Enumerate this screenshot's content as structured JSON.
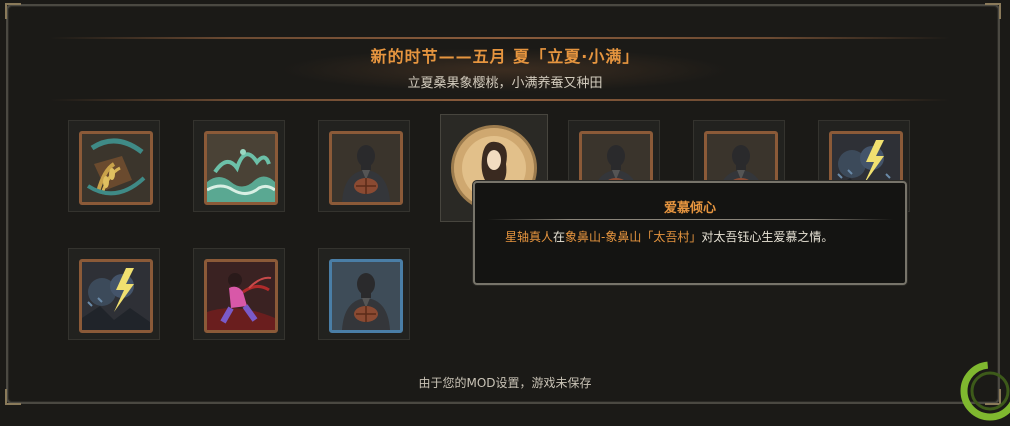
{
  "header": {
    "title": "新的时节——五月 夏「立夏·小满」",
    "subtitle": "立夏桑果象樱桃，小满养蚕又种田"
  },
  "events": [
    {
      "icon": "grain-harvest-icon"
    },
    {
      "icon": "sea-waves-icon"
    },
    {
      "icon": "person-holding-ball-icon"
    },
    {
      "icon": "woman-portrait-icon",
      "selected": true
    },
    {
      "icon": "person-holding-ball-icon"
    },
    {
      "icon": "person-holding-ball-icon"
    },
    {
      "icon": "lightning-storm-icon"
    },
    {
      "icon": "lightning-storm-icon"
    },
    {
      "icon": "martial-artist-icon"
    },
    {
      "icon": "person-holding-ball-icon",
      "frame": "blue"
    }
  ],
  "tooltip": {
    "title": "爱慕倾心",
    "name": "星轴真人",
    "word_at": "在",
    "location": "象鼻山-象鼻山「太吾村」",
    "rest": "对太吾钰心生爱慕之情。"
  },
  "footer": {
    "notice": "由于您的MOD设置，游戏未保存"
  },
  "colors": {
    "accent": "#e6953f",
    "background": "#1b1a17",
    "card_border": "#8b5a38",
    "blue_border": "#4a7ea6",
    "loading_ring": "#7fb82f"
  }
}
